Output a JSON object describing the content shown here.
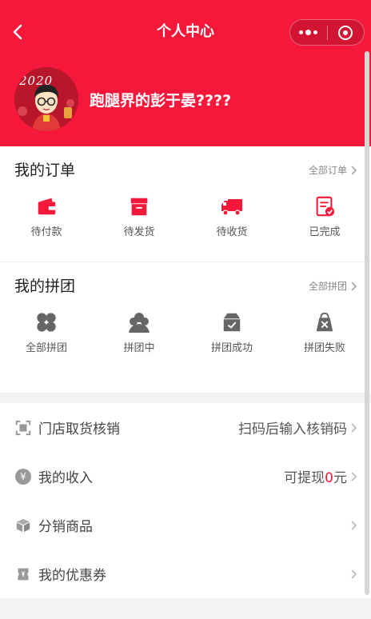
{
  "nav": {
    "title": "个人中心"
  },
  "profile": {
    "name": "跑腿界的彭于晏????",
    "avatar_text": "2020"
  },
  "orders": {
    "title": "我的订单",
    "more": "全部订单",
    "items": [
      {
        "label": "待付款",
        "icon": "wallet-icon"
      },
      {
        "label": "待发货",
        "icon": "box-icon"
      },
      {
        "label": "待收货",
        "icon": "truck-icon"
      },
      {
        "label": "已完成",
        "icon": "clipboard-check-icon"
      }
    ]
  },
  "groups": {
    "title": "我的拼团",
    "more": "全部拼团",
    "items": [
      {
        "label": "全部拼团",
        "icon": "clover-icon"
      },
      {
        "label": "拼团中",
        "icon": "people-icon"
      },
      {
        "label": "拼团成功",
        "icon": "box-check-icon"
      },
      {
        "label": "拼团失败",
        "icon": "bag-x-icon"
      }
    ]
  },
  "menu": {
    "pickup": {
      "label": "门店取货核销",
      "right": "扫码后输入核销码"
    },
    "income": {
      "label": "我的收入",
      "right_prefix": "可提现",
      "amount": "0",
      "unit": "元",
      "icon_char": "¥"
    },
    "distribution": {
      "label": "分销商品"
    },
    "coupons": {
      "label": "我的优惠券"
    }
  },
  "colors": {
    "brand": "#f5183a",
    "icon_gray": "#666666"
  }
}
